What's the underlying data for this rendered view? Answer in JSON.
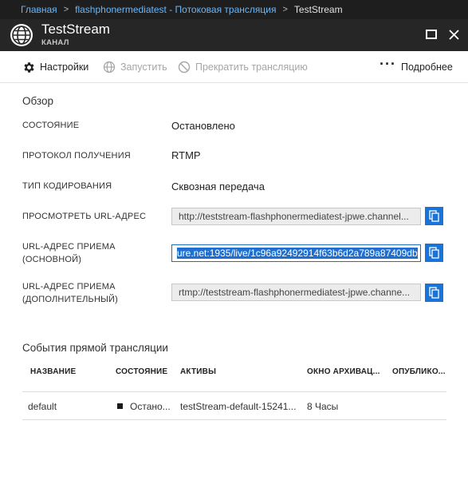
{
  "breadcrumb": {
    "items": [
      "Главная",
      "flashphonermediatest - Потоковая трансляция",
      "TestStream"
    ]
  },
  "header": {
    "title": "TestStream",
    "subtitle": "КАНАЛ",
    "icon": "globe-icon"
  },
  "toolbar": {
    "settings": "Настройки",
    "start": "Запустить",
    "stop": "Прекратить трансляцию",
    "more": "Подробнее"
  },
  "overview": {
    "title": "Обзор",
    "state_label": "СОСТОЯНИЕ",
    "state_value": "Остановлено",
    "protocol_label": "ПРОТОКОЛ ПОЛУЧЕНИЯ",
    "protocol_value": "RTMP",
    "encoding_label": "ТИП КОДИРОВАНИЯ",
    "encoding_value": "Сквозная передача",
    "preview_label": "ПРОСМОТРЕТЬ URL-АДРЕС",
    "preview_url": "http://teststream-flashphonermediatest-jpwe.channel...",
    "primary_label_1": "URL-АДРЕС ПРИЕМА",
    "primary_label_2": "(ОСНОВНОЙ)",
    "primary_url": "ure.net:1935/live/1c96a92492914f63b6d2a789a87409db",
    "secondary_label_1": "URL-АДРЕС ПРИЕМА",
    "secondary_label_2": "(ДОПОЛНИТЕЛЬНЫЙ)",
    "secondary_url": "rtmp://teststream-flashphonermediatest-jpwe.channe..."
  },
  "events": {
    "title": "События прямой трансляции",
    "columns": [
      "НАЗВАНИЕ",
      "СОСТОЯНИЕ",
      "АКТИВЫ",
      "ОКНО АРХИВАЦ...",
      "ОПУБЛИКО..."
    ],
    "rows": [
      {
        "name": "default",
        "state": "Остано...",
        "assets": "testStream-default-15241...",
        "archive": "8 Часы",
        "published": ""
      }
    ]
  },
  "colors": {
    "accent": "#1a73d9",
    "breadcrumb_link": "#6cb6f5",
    "titlebar_bg": "#262626",
    "breadcrumb_bg": "#1e1e1e"
  }
}
